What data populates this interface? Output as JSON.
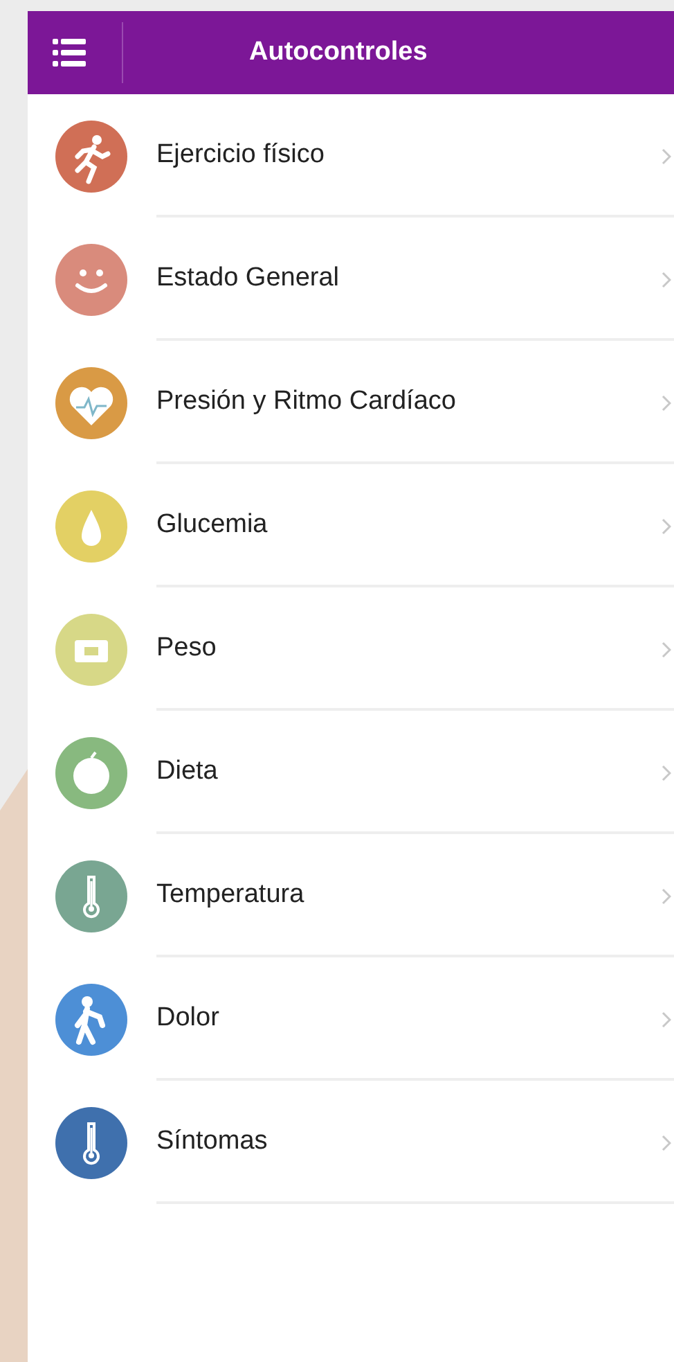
{
  "header": {
    "title": "Autocontroles"
  },
  "items": [
    {
      "label": "Ejercicio físico",
      "kind": "runner",
      "color": "#d06f56"
    },
    {
      "label": "Estado General",
      "kind": "smiley",
      "color": "#d98b7c"
    },
    {
      "label": "Presión y Ritmo Cardíaco",
      "kind": "heart",
      "color": "#d99a45"
    },
    {
      "label": "Glucemia",
      "kind": "drop",
      "color": "#e3d064"
    },
    {
      "label": "Peso",
      "kind": "scale",
      "color": "#d7d887"
    },
    {
      "label": "Dieta",
      "kind": "apple",
      "color": "#88b97f"
    },
    {
      "label": "Temperatura",
      "kind": "thermometer",
      "color": "#79a692"
    },
    {
      "label": "Dolor",
      "kind": "person",
      "color": "#4d8fd6"
    },
    {
      "label": "Síntomas",
      "kind": "thermometer",
      "color": "#3f70ad"
    }
  ]
}
